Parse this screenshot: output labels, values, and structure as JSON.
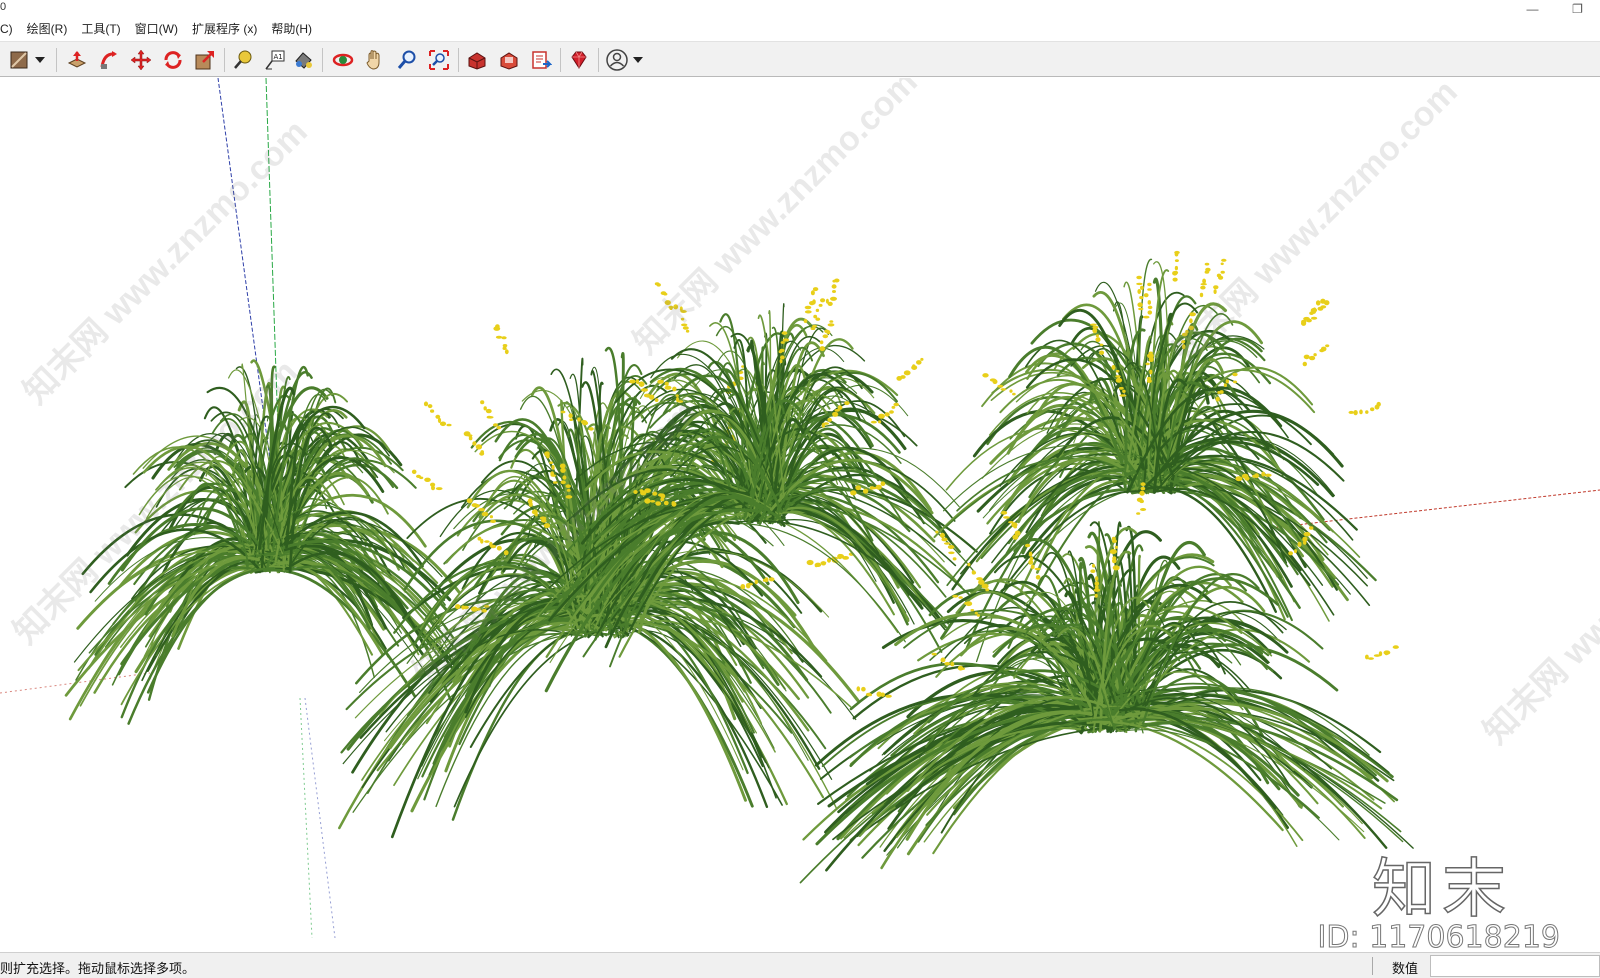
{
  "window": {
    "title_fragment": "0",
    "minimize_glyph": "—",
    "restore_glyph": "❐"
  },
  "menu": {
    "items": [
      {
        "label": "C)"
      },
      {
        "label": "绘图(R)"
      },
      {
        "label": "工具(T)"
      },
      {
        "label": "窗口(W)"
      },
      {
        "label": "扩展程序 (x)"
      },
      {
        "label": "帮助(H)"
      }
    ]
  },
  "toolbar": {
    "buttons": [
      {
        "name": "paint-bucket-icon"
      },
      {
        "name": "paint-dropdown-icon"
      },
      {
        "name": "push-pull-icon"
      },
      {
        "name": "follow-me-icon"
      },
      {
        "name": "move-icon"
      },
      {
        "name": "rotate-icon"
      },
      {
        "name": "scale-icon"
      },
      {
        "name": "tape-measure-icon"
      },
      {
        "name": "text-icon"
      },
      {
        "name": "paint-icon"
      },
      {
        "name": "orbit-icon"
      },
      {
        "name": "pan-icon"
      },
      {
        "name": "zoom-icon"
      },
      {
        "name": "zoom-extents-icon"
      },
      {
        "name": "warehouse-icon"
      },
      {
        "name": "extension-warehouse-icon"
      },
      {
        "name": "layout-icon"
      },
      {
        "name": "ruby-icon"
      },
      {
        "name": "account-icon"
      },
      {
        "name": "account-dropdown-icon"
      }
    ],
    "text_tool_glyph": "A1"
  },
  "viewport": {
    "background": "#ffffff",
    "watermark_text": "知末网 www.znzmo.com",
    "logo_text": "知末",
    "id_text": "ID: 1170618219",
    "colors": {
      "grass_dark": "#2f5e1f",
      "grass_mid": "#4a7d2c",
      "grass_light": "#6e9a3c",
      "flower": "#e8cf1a",
      "axis_red": "#c0392b",
      "axis_green": "#27a844",
      "axis_blue": "#2e3fa8"
    }
  },
  "status": {
    "message": "则扩充选择。拖动鼠标选择多项。",
    "measurements_label": "数值",
    "measurements_value": ""
  }
}
